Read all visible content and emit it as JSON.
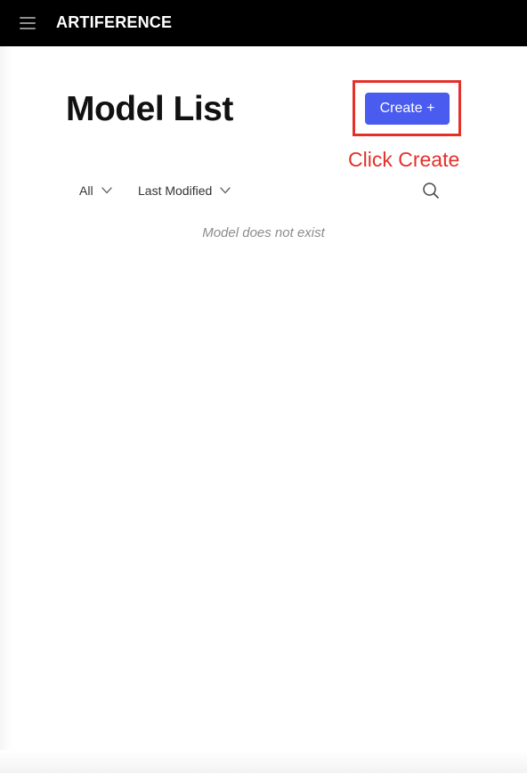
{
  "topbar": {
    "brand": "ARTIFERENCE",
    "menu_icon": "hamburger-menu-icon"
  },
  "main": {
    "title": "Model List",
    "create_button_label": "Create +",
    "filters": {
      "category": "All",
      "sort": "Last Modified",
      "dropdown_icon": "chevron-down-icon",
      "search_icon": "search-icon"
    },
    "empty_message": "Model does not exist"
  },
  "annotation": {
    "text": "Click Create",
    "color": "#e5302a"
  },
  "colors": {
    "topbar_bg": "#000000",
    "accent": "#4a5cf0",
    "highlight": "#e5302a"
  }
}
